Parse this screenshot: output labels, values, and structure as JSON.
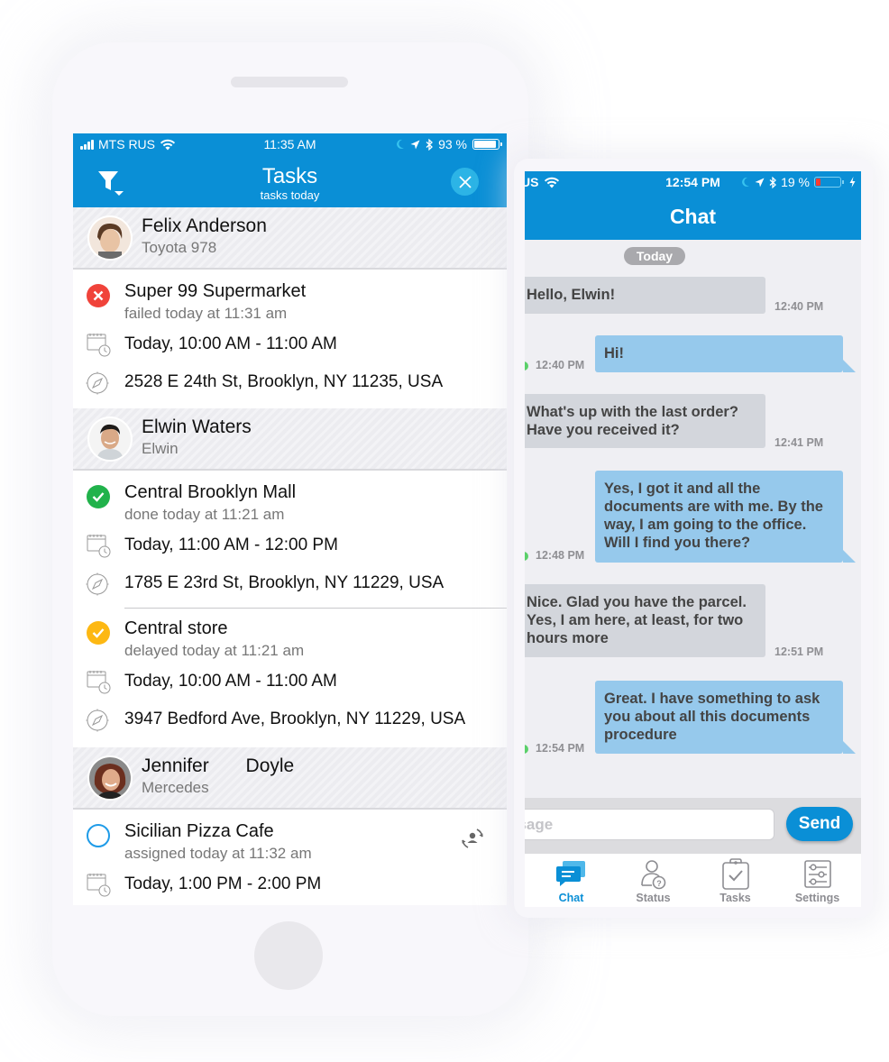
{
  "tasks_app": {
    "status_bar": {
      "carrier": "MTS RUS",
      "time": "11:35 AM",
      "battery": "93 %",
      "battery_level": 0.93
    },
    "header": {
      "title": "Tasks",
      "subtitle": "tasks today",
      "filter_icon": "filter-icon",
      "close_icon": "close-icon"
    },
    "drivers": [
      {
        "name": "Felix Anderson",
        "vehicle": "Toyota 978",
        "tasks": [
          {
            "name": "Super 99 Supermarket",
            "status": "failed today at 11:31 am",
            "status_type": "failed",
            "time": "Today, 10:00 AM - 11:00 AM",
            "address": "2528 E 24th St, Brooklyn, NY 11235, USA"
          }
        ]
      },
      {
        "name": "Elwin Waters",
        "vehicle": "Elwin",
        "tasks": [
          {
            "name": "Central Brooklyn Mall",
            "status": "done today at 11:21 am",
            "status_type": "done",
            "time": "Today, 11:00 AM - 12:00 PM",
            "address": "1785 E 23rd St, Brooklyn, NY 11229, USA"
          },
          {
            "name": "Central store",
            "status": "delayed today at 11:21 am",
            "status_type": "delayed",
            "time": "Today, 10:00 AM - 11:00 AM",
            "address": "3947 Bedford Ave, Brooklyn, NY 11229, USA"
          }
        ]
      },
      {
        "name": "Jennifer       Doyle",
        "vehicle": "Mercedes",
        "tasks": [
          {
            "name": "Sicilian Pizza Cafe",
            "status": "assigned today at 11:32 am",
            "status_type": "assigned",
            "time": "Today, 1:00 PM - 2:00 PM"
          }
        ]
      }
    ]
  },
  "chat_app": {
    "status_bar": {
      "carrier_partial": "US",
      "time": "12:54 PM",
      "battery": "19 %",
      "battery_level": 0.19
    },
    "header": {
      "title": "Chat"
    },
    "date_label": "Today",
    "messages": [
      {
        "direction": "in",
        "text": "Hello, Elwin!",
        "time": "12:40 PM"
      },
      {
        "direction": "out",
        "text": "Hi!",
        "time": "12:40 PM"
      },
      {
        "direction": "in",
        "text": "What's up with the last order? Have you received it?",
        "time": "12:41 PM"
      },
      {
        "direction": "out",
        "text": "Yes, I got it and all the documents are with me. By the way, I am going to the office. Will I find you there?",
        "time": "12:48 PM"
      },
      {
        "direction": "in",
        "text": "Nice. Glad you have the parcel. Yes, I am here, at least, for two hours more",
        "time": "12:51 PM"
      },
      {
        "direction": "out",
        "text": "Great. I have something to ask you about all this documents procedure",
        "time": "12:54 PM"
      }
    ],
    "composer": {
      "placeholder": "Message",
      "visible_placeholder": "ssage",
      "send_label": "Send"
    },
    "tabs": [
      {
        "label": "Chat",
        "icon": "chat-icon",
        "active": true
      },
      {
        "label": "Status",
        "icon": "status-icon",
        "active": false
      },
      {
        "label": "Tasks",
        "icon": "tasks-clipboard-icon",
        "active": false
      },
      {
        "label": "Settings",
        "icon": "settings-sliders-icon",
        "active": false
      }
    ]
  },
  "colors": {
    "brand_blue": "#0a8fd6",
    "failed": "#f0433a",
    "done": "#21b24b",
    "delayed": "#fdb813",
    "assigned": "#1e9be8",
    "incoming_bubble": "#d3d6dc",
    "outgoing_bubble": "#96c9ec"
  }
}
